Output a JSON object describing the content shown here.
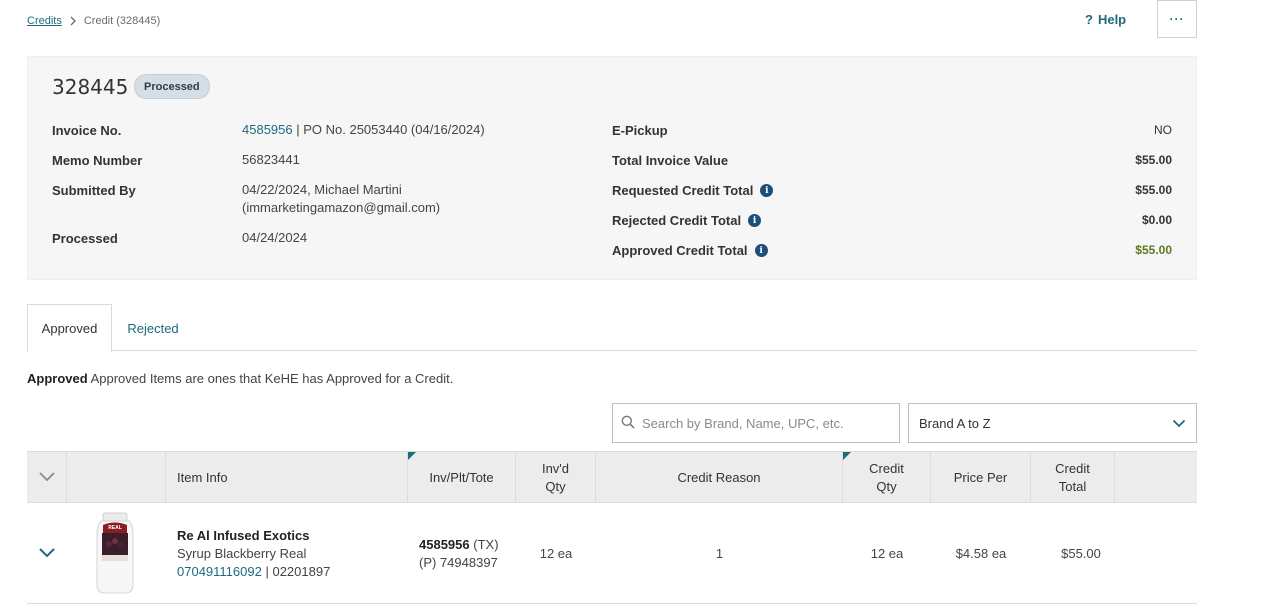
{
  "breadcrumb": {
    "root": "Credits",
    "current": "Credit (328445)"
  },
  "header": {
    "help_label": "Help",
    "help_icon": "?",
    "more_label": "···"
  },
  "credit": {
    "id": "328445",
    "status": "Processed",
    "left_fields": {
      "invoice_label": "Invoice No.",
      "invoice_link": "4585956",
      "invoice_rest": "| PO No. 25053440 (04/16/2024)",
      "memo_label": "Memo Number",
      "memo_value": "56823441",
      "submitted_label": "Submitted By",
      "submitted_line1": "04/22/2024, Michael Martini",
      "submitted_line2": "(immarketingamazon@gmail.com)",
      "processed_label": "Processed",
      "processed_value": "04/24/2024"
    },
    "right_fields": {
      "epickup_label": "E-Pickup",
      "epickup_value": "NO",
      "total_invoice_label": "Total Invoice Value",
      "total_invoice_value": "$55.00",
      "requested_label": "Requested Credit Total",
      "requested_value": "$55.00",
      "rejected_label": "Rejected Credit Total",
      "rejected_value": "$0.00",
      "approved_label": "Approved Credit Total",
      "approved_value": "$55.00"
    }
  },
  "tabs": [
    {
      "label": "Approved",
      "active": true
    },
    {
      "label": "Rejected",
      "active": false
    }
  ],
  "approved_note": {
    "bold": "Approved",
    "text": " Approved Items are ones that KeHE has Approved for a Credit."
  },
  "search": {
    "placeholder": "Search by Brand, Name, UPC, etc."
  },
  "sort": {
    "selected": "Brand A to Z"
  },
  "table": {
    "headers": {
      "item_info": "Item Info",
      "inv_plt_tote": "Inv/Plt/Tote",
      "invd_qty_1": "Inv'd",
      "invd_qty_2": "Qty",
      "credit_reason": "Credit Reason",
      "credit_qty_1": "Credit",
      "credit_qty_2": "Qty",
      "price_per": "Price Per",
      "credit_total_1": "Credit",
      "credit_total_2": "Total"
    },
    "rows": [
      {
        "brand": "Re Al Infused Exotics",
        "description": "Syrup Blackberry Real",
        "upc_link": "070491116092",
        "item_number": "| 02201897",
        "invoice_bold": "4585956",
        "invoice_suffix": "(TX)",
        "pallet": "(P) 74948397",
        "invd_qty": "12 ea",
        "credit_reason": "1",
        "credit_qty": "12 ea",
        "price_per": "$4.58 ea",
        "credit_total": "$55.00",
        "image_label": "REAL"
      }
    ]
  },
  "colors": {
    "accent": "#1e6a7f",
    "approved_green": "#5d7a1f",
    "info_blue": "#1d4f7a"
  }
}
